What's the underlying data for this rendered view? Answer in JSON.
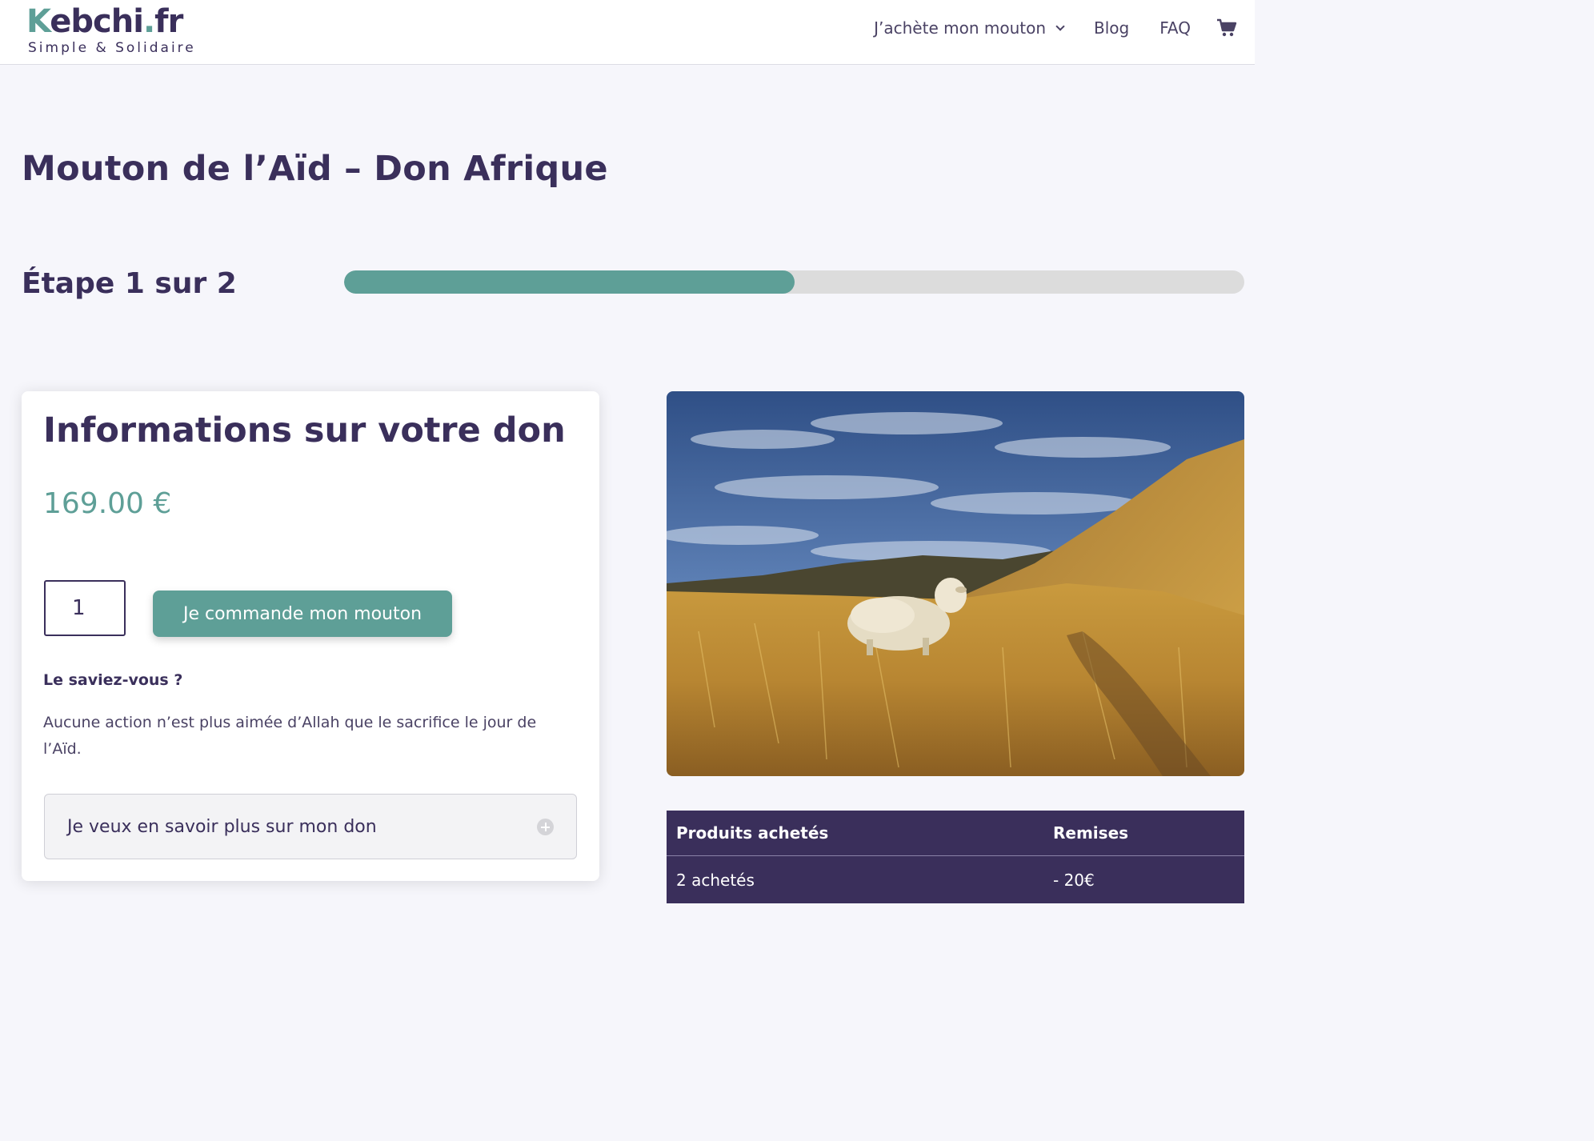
{
  "header": {
    "logo": {
      "k": "K",
      "rest": "ebchi",
      "dot": ".",
      "tld": "fr",
      "tagline": "Simple & Solidaire"
    },
    "nav": [
      {
        "label": "J’achète mon mouton",
        "has_dropdown": true
      },
      {
        "label": "Blog"
      },
      {
        "label": "FAQ"
      }
    ],
    "cart_icon": "cart-icon"
  },
  "page": {
    "title": "Mouton de l’Aïd – Don Afrique",
    "step": {
      "label": "Étape 1 sur 2",
      "current": 1,
      "total": 2,
      "progress": 0.5
    }
  },
  "card": {
    "title": "Informations sur votre don",
    "price": "169.00 €",
    "quantity": "1",
    "order_button": "Je commande mon mouton",
    "did_you_know": "Le saviez-vous ?",
    "fact": "Aucune action n’est plus aimée d’Allah que le sacrifice le jour de l’Aïd.",
    "accordion_label": "Je veux en savoir plus sur mon don"
  },
  "image": {
    "subject": "sheep in golden grass field under blue cloudy sky"
  },
  "discount_table": {
    "headers": [
      "Produits achetés",
      "Remises"
    ],
    "rows": [
      [
        "2 achetés",
        "- 20€"
      ]
    ]
  },
  "colors": {
    "primary": "#3a2f5b",
    "accent": "#5e9f97",
    "background": "#f6f6fb",
    "track": "#dcdcdc"
  }
}
